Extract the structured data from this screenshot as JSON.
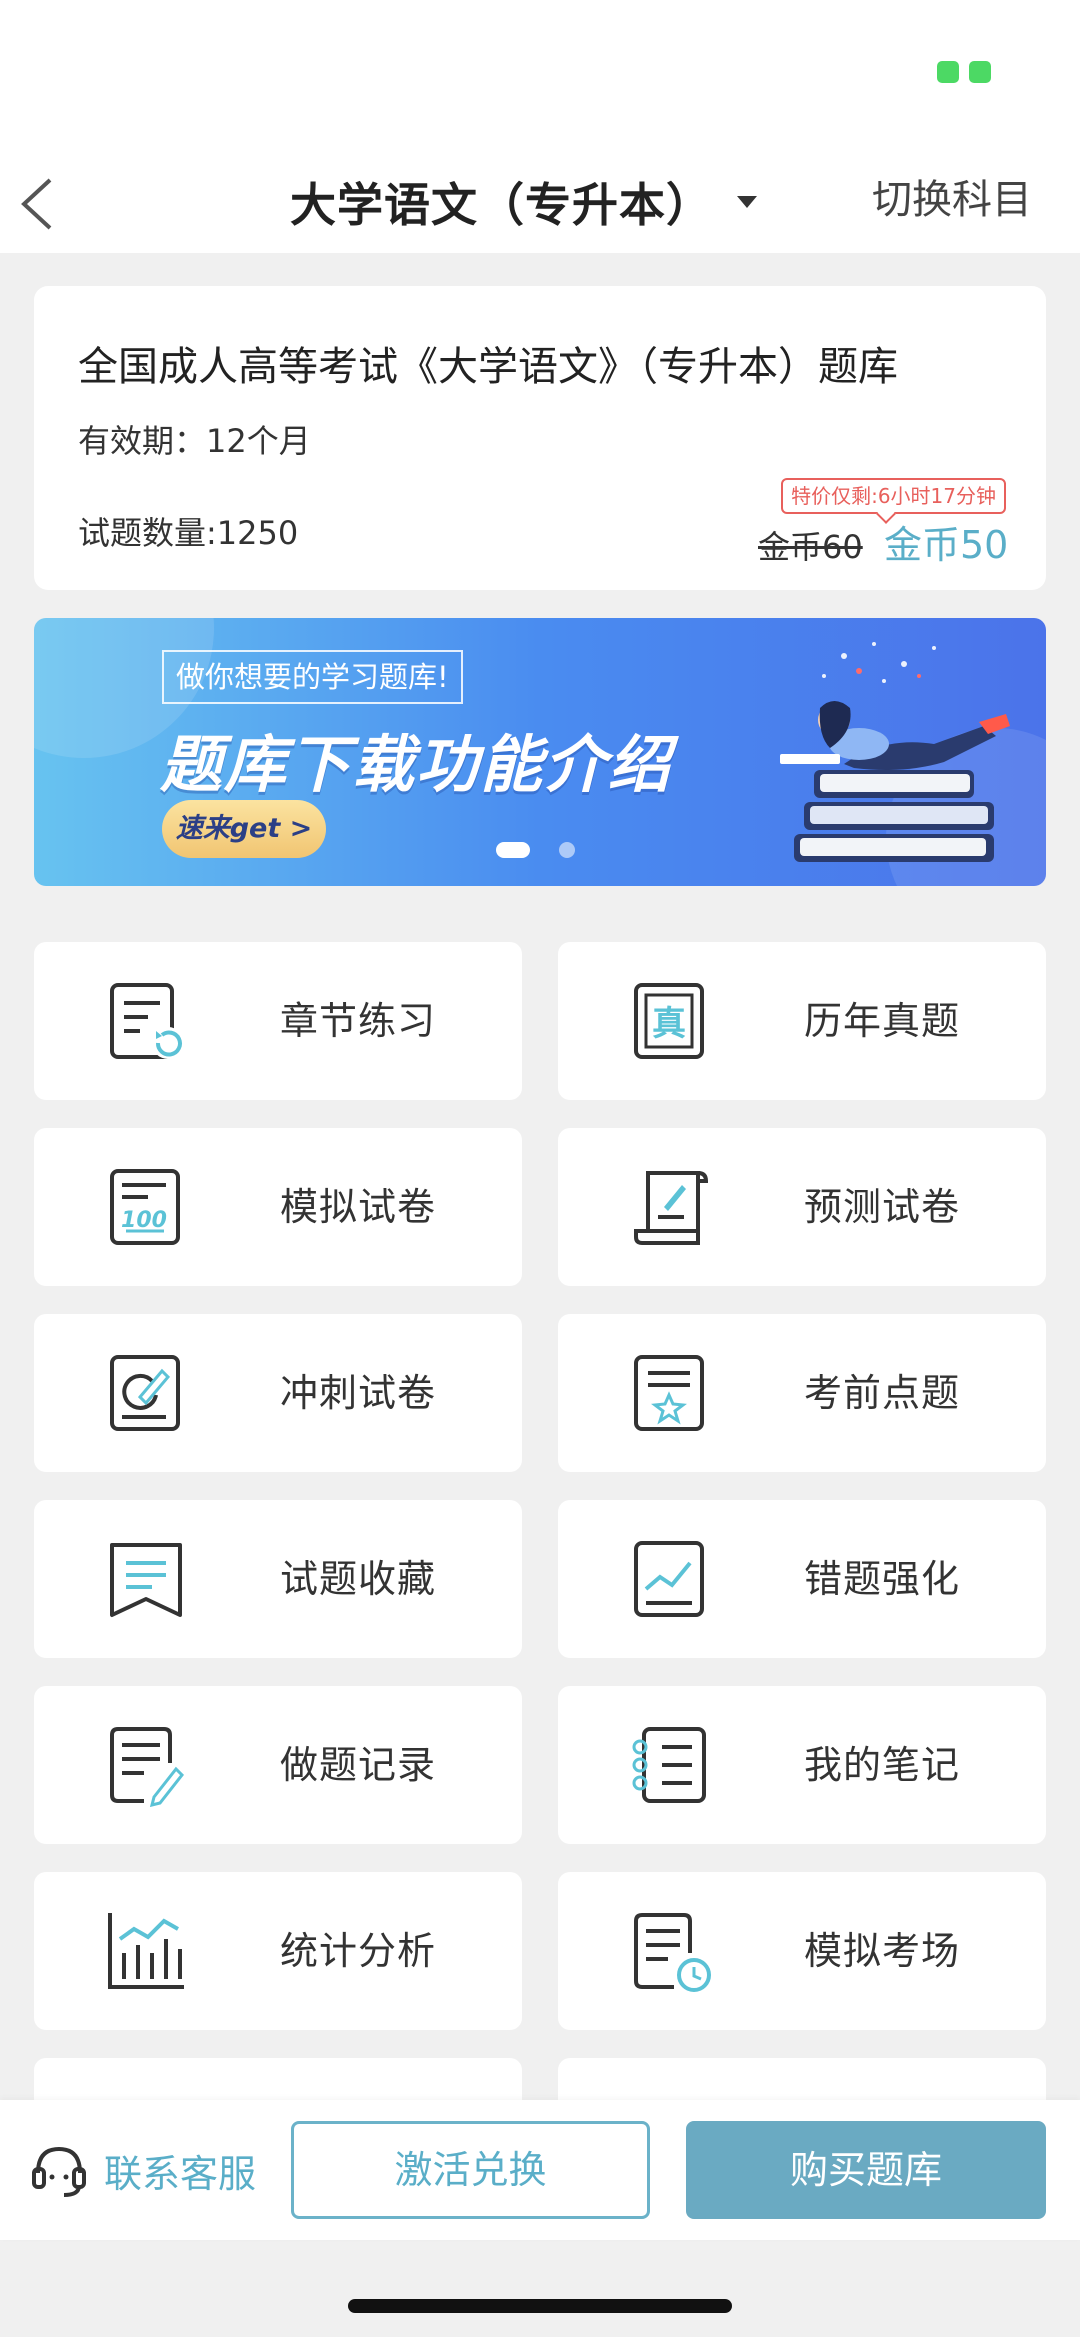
{
  "nav": {
    "title": "大学语文（专升本）",
    "switch_label": "切换科目"
  },
  "info": {
    "title": "全国成人高等考试《大学语文》（专升本）题库",
    "validity": "有效期：12个月",
    "count": "试题数量:1250",
    "promo_badge": "特价仅剩:6小时17分钟",
    "old_price": "金币60",
    "new_price": "金币50"
  },
  "banner": {
    "tag": "做你想要的学习题库!",
    "title": "题库下载功能介绍",
    "button": "速来get >",
    "slides": 2,
    "active_slide": 0
  },
  "tiles": [
    {
      "label": "章节练习",
      "icon": "chapter-practice-icon"
    },
    {
      "label": "历年真题",
      "icon": "past-exams-icon"
    },
    {
      "label": "模拟试卷",
      "icon": "mock-paper-icon"
    },
    {
      "label": "预测试卷",
      "icon": "prediction-paper-icon"
    },
    {
      "label": "冲刺试卷",
      "icon": "sprint-paper-icon"
    },
    {
      "label": "考前点题",
      "icon": "key-points-icon"
    },
    {
      "label": "试题收藏",
      "icon": "favorites-icon"
    },
    {
      "label": "错题强化",
      "icon": "wrong-questions-icon"
    },
    {
      "label": "做题记录",
      "icon": "practice-record-icon"
    },
    {
      "label": "我的笔记",
      "icon": "notes-icon"
    },
    {
      "label": "统计分析",
      "icon": "statistics-icon"
    },
    {
      "label": "模拟考场",
      "icon": "mock-exam-room-icon"
    }
  ],
  "bottom": {
    "customer_service": "联系客服",
    "redeem": "激活兑换",
    "buy": "购买题库"
  },
  "colors": {
    "accent": "#5aaec8",
    "buy_button": "#6aaac2",
    "promo_red": "#e8605c",
    "icon_dark": "#333333"
  }
}
